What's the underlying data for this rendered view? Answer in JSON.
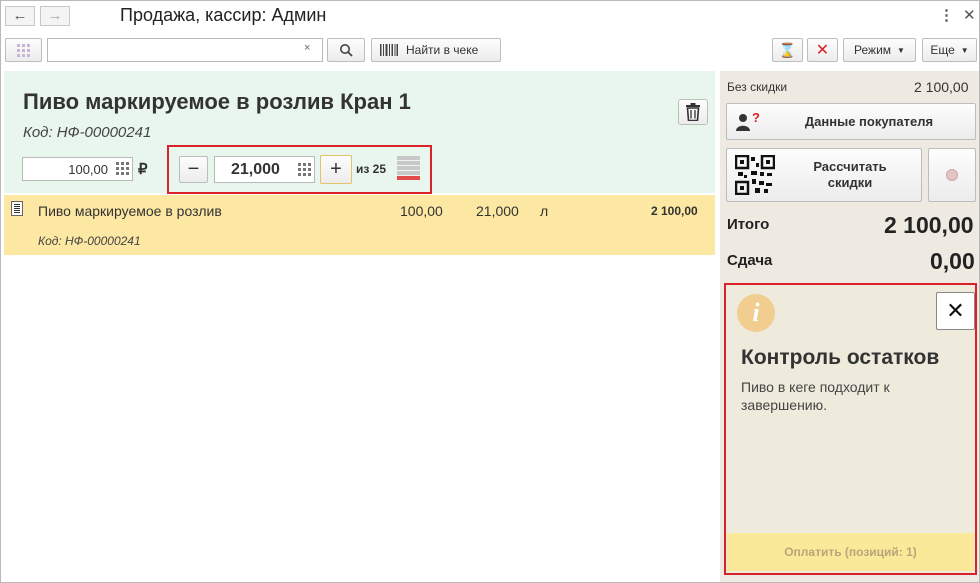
{
  "window": {
    "title": "Продажа, кассир: Админ"
  },
  "toolbar": {
    "search_value": "",
    "find_in_check_label": "Найти в чеке",
    "mode_label": "Режим",
    "more_label": "Еще"
  },
  "product": {
    "title": "Пиво маркируемое в розлив Кран 1",
    "code": "Код: НФ-00000241",
    "price": "100,00",
    "currency": "₽",
    "quantity": "21,000",
    "stock_label": "из 25"
  },
  "line_item": {
    "name": "Пиво маркируемое в розлив",
    "price": "100,00",
    "quantity": "21,000",
    "unit": "л",
    "total": "2 100,00",
    "code": "Код: НФ-00000241"
  },
  "summary": {
    "no_discount_label": "Без скидки",
    "no_discount_value": "2 100,00",
    "buyer_data_label": "Данные покупателя",
    "calc_discounts_label": "Рассчитать скидки",
    "total_label": "Итого",
    "total_value": "2 100,00",
    "change_label": "Сдача",
    "change_value": "0,00"
  },
  "notification": {
    "title": "Контроль остатков",
    "text": "Пиво в кеге подходит к завершению."
  },
  "pay_button": {
    "label": "Оплатить (позиций: 1)"
  },
  "colors": {
    "product_panel_bg": "#e9f6ee",
    "selected_row_bg": "#fce8a3",
    "right_panel_bg": "#efeae1",
    "highlight_border": "#d9212a",
    "pay_button_bg": "#fbe99a"
  }
}
